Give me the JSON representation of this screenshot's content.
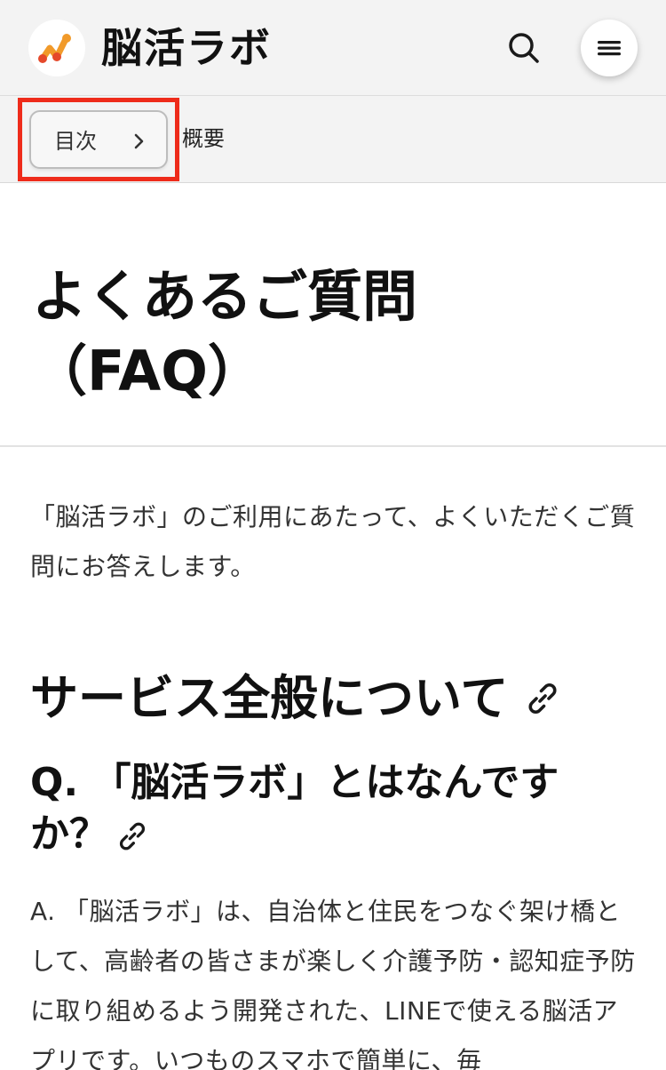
{
  "header": {
    "logo_text": "脳活ラボ",
    "logo_colors": {
      "orange": "#f19a2a",
      "red": "#e5492b"
    }
  },
  "toc": {
    "button_label": "目次",
    "current_section": "概要",
    "highlight_color": "#ee2b1a"
  },
  "main": {
    "title": "よくあるご質問（FAQ）",
    "intro": "「脳活ラボ」のご利用にあたって、よくいただくご質問にお答えします。",
    "section_heading": "サービス全般について",
    "question": "Q. 「脳活ラボ」とはなんですか？",
    "answer": "A. 「脳活ラボ」は、自治体と住民をつなぐ架け橋として、高齢者の皆さまが楽しく介護予防・認知症予防に取り組めるよう開発された、LINEで使える脳活アプリです。いつものスマホで簡単に、毎"
  }
}
